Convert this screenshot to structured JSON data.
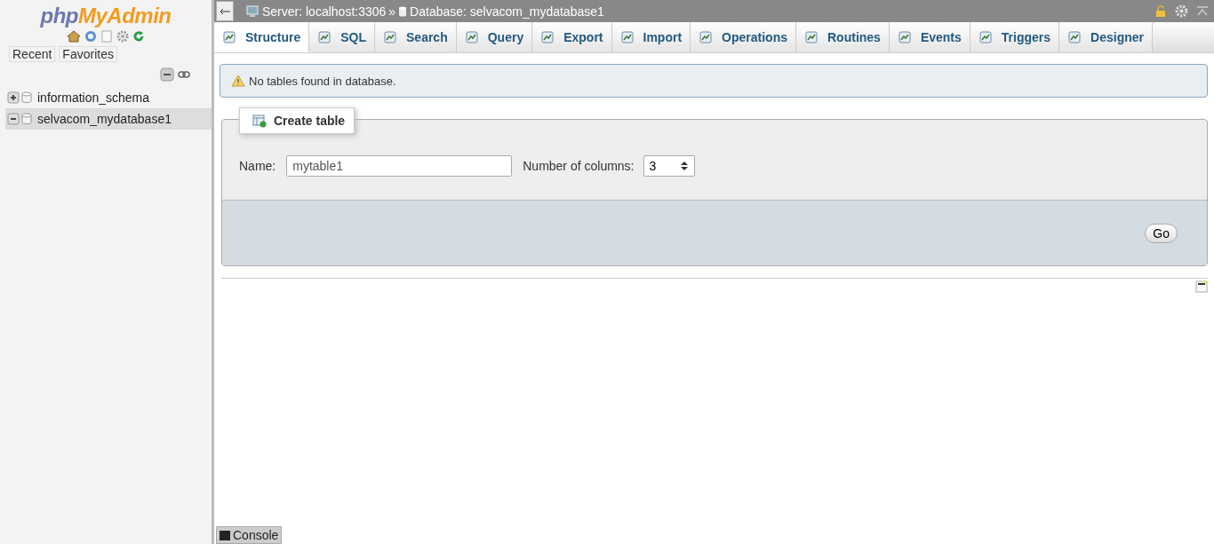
{
  "sidebar": {
    "logo": {
      "php": "php",
      "rest": "MyAdmin"
    },
    "nav_tabs": [
      "Recent",
      "Favorites"
    ],
    "tree": [
      {
        "label": "information_schema",
        "expanded": false,
        "selected": false
      },
      {
        "label": "selvacom_mydatabase1",
        "expanded": true,
        "selected": true
      }
    ]
  },
  "breadcrumb": {
    "server": "Server: localhost:3306",
    "separator": "»",
    "database": "Database: selvacom_mydatabase1"
  },
  "tabs": [
    {
      "label": "Structure",
      "selected": true
    },
    {
      "label": "SQL",
      "selected": false
    },
    {
      "label": "Search",
      "selected": false
    },
    {
      "label": "Query",
      "selected": false
    },
    {
      "label": "Export",
      "selected": false
    },
    {
      "label": "Import",
      "selected": false
    },
    {
      "label": "Operations",
      "selected": false
    },
    {
      "label": "Routines",
      "selected": false
    },
    {
      "label": "Events",
      "selected": false
    },
    {
      "label": "Triggers",
      "selected": false
    },
    {
      "label": "Designer",
      "selected": false
    }
  ],
  "notice": "No tables found in database.",
  "create_table": {
    "legend": "Create table",
    "name_label": "Name:",
    "name_value": "mytable1",
    "columns_label": "Number of columns:",
    "columns_value": "3",
    "go": "Go"
  },
  "console": "Console"
}
